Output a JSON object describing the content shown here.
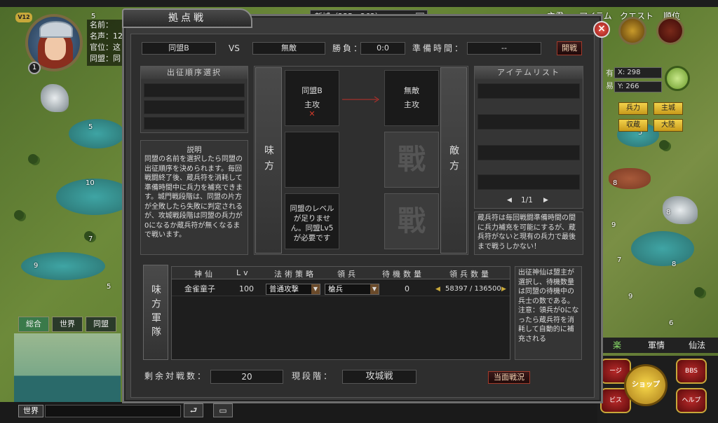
{
  "map": {
    "tile_numbers": [
      "5",
      "5",
      "10",
      "7",
      "7",
      "9",
      "5",
      "8",
      "9",
      "5",
      "8",
      "7",
      "8",
      "9",
      "6"
    ]
  },
  "player": {
    "vip": "V12",
    "level": "1",
    "info": [
      "名前：",
      "名声：12",
      "官位：这",
      "同盟：同"
    ]
  },
  "coords": {
    "city": "新城（235，262）"
  },
  "top_right": {
    "labels": [
      "主君",
      "アイテム",
      "クエスト",
      "順位"
    ]
  },
  "minimap": {
    "x_label": "X:",
    "x": "298",
    "y_label": "Y:",
    "y": "266",
    "row_prefix": [
      "有",
      "易"
    ]
  },
  "map_buttons": [
    "兵力",
    "主城",
    "収蔵",
    "大陸"
  ],
  "chat": {
    "tabs": [
      "総合",
      "世界",
      "同盟"
    ],
    "active": "総合",
    "channel": "世界"
  },
  "bottom_icons": [
    "⮐",
    "▭"
  ],
  "bottom_tabs": [
    "楽",
    "軍情",
    "仙法"
  ],
  "hex_menu": {
    "shop": "ショップ",
    "items": [
      "ージ",
      "BBS",
      "ビス",
      "ヘルプ"
    ]
  },
  "dialog": {
    "title": "拠点戦",
    "close": "×",
    "alliance": "同盟B",
    "vs": "VS",
    "enemy": "無敵",
    "record_label": "勝負：",
    "record": "0:0",
    "prep_label": "準備時間：",
    "prep": "--",
    "start_btn": "開戦",
    "order_panel": {
      "title": "出征順序選択"
    },
    "explain": {
      "title": "説明",
      "text": "同盟の名前を選択したら同盟の出征順序を決められます。毎回戦闘終了後、蔵兵符を消耗して準備時間中に兵力を補充できます。城門戦段階は、同盟の片方が全敗したら失敗に判定されるが、攻城戦段階は同盟の兵力が0になるか蔵兵符が無くなるまで戦います。"
    },
    "ally_side": "味方",
    "enemy_side": "敵方",
    "ally_cell": {
      "name": "同盟B",
      "role": "主攻",
      "mark": "✕"
    },
    "enemy_cell": {
      "name": "無敵",
      "role": "主攻"
    },
    "battle_glyph": "戰",
    "level_note": "同盟のレベルが足りません。同盟Lv5が必要です",
    "item_panel": {
      "title": "アイテムリスト",
      "page": "1/1",
      "prev": "◀",
      "next": "▶"
    },
    "item_note": "蔵兵符は毎回戦闘準備時間の間に兵力補充を可能にするが、蔵兵符がないと現有の兵力で最後まで戦うしかない！",
    "troops": {
      "side_label": "味方軍隊",
      "headers": [
        "神仙",
        "Lv",
        "法術策略",
        "領兵",
        "待機数量",
        "領兵数量"
      ],
      "rows": [
        {
          "name": "金雀童子",
          "lv": "100",
          "strategy": "普通攻撃",
          "unit": "槍兵",
          "wait": "0",
          "amount": "58397 / 136500"
        }
      ],
      "note": "出征神仙は盟主が選択し、待機数量は同盟の待機中の兵士の数である。注意：領兵が0になったら蔵兵符を消耗して自動的に補充される"
    },
    "remaining_label": "剰余対戦数：",
    "remaining": "20",
    "stage_label": "現段階：",
    "stage": "攻城戦",
    "current_btn": "当面戦況"
  }
}
